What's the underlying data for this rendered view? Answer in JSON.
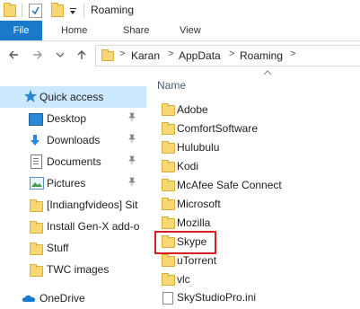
{
  "window": {
    "title": "Roaming"
  },
  "ribbon": {
    "file": "File",
    "home": "Home",
    "share": "Share",
    "view": "View"
  },
  "address": {
    "crumbs": [
      "Karan",
      "AppData",
      "Roaming"
    ],
    "separator": ">"
  },
  "column": {
    "name": "Name"
  },
  "nav": {
    "quick_access": "Quick access",
    "items": [
      {
        "label": "Desktop",
        "icon": "desktop-icon",
        "pinned": true
      },
      {
        "label": "Downloads",
        "icon": "downloads-icon",
        "pinned": true
      },
      {
        "label": "Documents",
        "icon": "documents-icon",
        "pinned": true
      },
      {
        "label": "Pictures",
        "icon": "pictures-icon",
        "pinned": true
      },
      {
        "label": "[Indiangfvideos] Sit",
        "icon": "folder-icon",
        "pinned": false
      },
      {
        "label": "Install Gen-X add-o",
        "icon": "folder-icon",
        "pinned": false
      },
      {
        "label": "Stuff",
        "icon": "folder-icon",
        "pinned": false
      },
      {
        "label": "TWC images",
        "icon": "folder-icon",
        "pinned": false
      },
      {
        "label": "OneDrive",
        "icon": "onedrive-icon",
        "pinned": false
      }
    ]
  },
  "files": [
    {
      "label": "Adobe",
      "type": "folder"
    },
    {
      "label": "ComfortSoftware",
      "type": "folder"
    },
    {
      "label": "Hulubulu",
      "type": "folder"
    },
    {
      "label": "Kodi",
      "type": "folder"
    },
    {
      "label": "McAfee Safe Connect",
      "type": "folder"
    },
    {
      "label": "Microsoft",
      "type": "folder"
    },
    {
      "label": "Mozilla",
      "type": "folder"
    },
    {
      "label": "Skype",
      "type": "folder"
    },
    {
      "label": "uTorrent",
      "type": "folder"
    },
    {
      "label": "vlc",
      "type": "folder"
    },
    {
      "label": "SkyStudioPro.ini",
      "type": "file"
    }
  ],
  "colors": {
    "accent": "#1979ca",
    "selection": "#cce8ff",
    "highlight": "#d61f1f",
    "folder": "#f8d775"
  }
}
